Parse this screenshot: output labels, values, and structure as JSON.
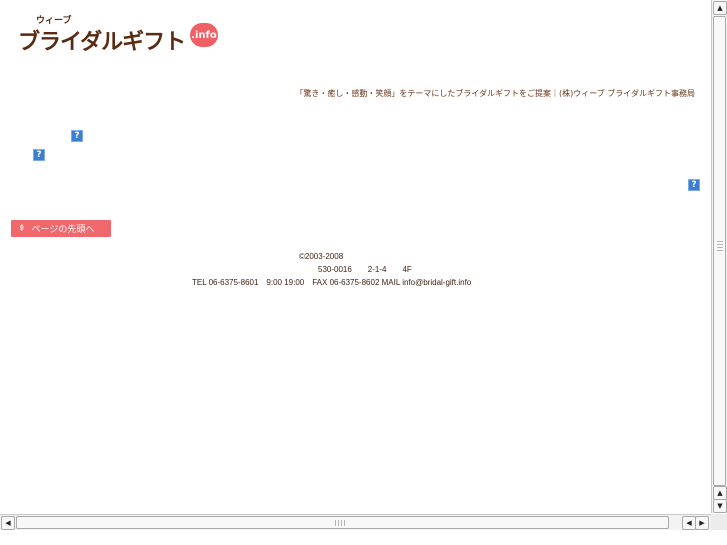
{
  "header": {
    "logo_small": "ウィーブ",
    "logo_main": "ブライダルギフト",
    "logo_badge": ".info",
    "tagline": "「驚き・癒し・感動・笑顔」をテーマにしたブライダルギフトをご提案｜(株)ウィーブ ブライダルギフト事務局"
  },
  "broken_image_glyph": "?",
  "page_top_button": {
    "label": "ページの先頭へ",
    "arrow": "⇞"
  },
  "footer": {
    "copyright": "©2003-2008",
    "address": "530-0016　　2-1-4　　4F",
    "contact": "TEL 06-6375-8601　9:00 19:00　FAX 06-6375-8602 MAIL info@bridal-gift.info"
  },
  "scrollbars": {
    "up_arrow": "▲",
    "down_arrow": "▼",
    "left_arrow": "◀",
    "right_arrow": "▶"
  }
}
